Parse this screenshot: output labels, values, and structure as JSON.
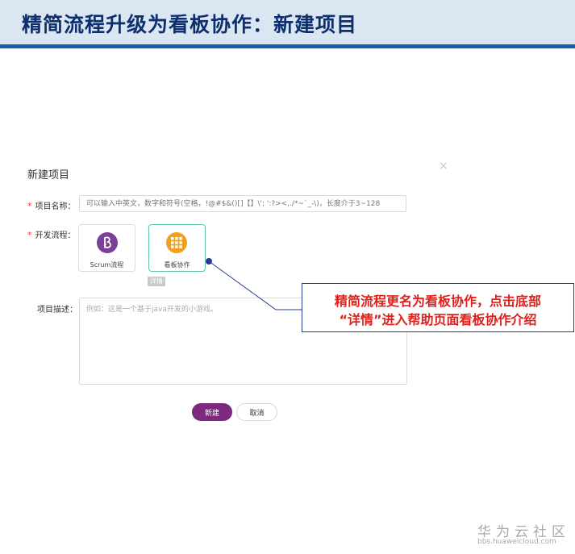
{
  "slide": {
    "title": "精简流程升级为看板协作：新建项目",
    "accent_color": "#1a5fae"
  },
  "dialog": {
    "title": "新建项目",
    "close_glyph": "×",
    "required_mark": "*",
    "name_field": {
      "label": "项目名称：",
      "placeholder": "可以输入中英文，数字和符号(空格，!@#$&()[]【】\\'; ':?><,./*~`_-\\)，长度介于3~128"
    },
    "process_field": {
      "label": "开发流程：",
      "options": [
        {
          "label": "Scrum流程",
          "icon": "scrum-icon",
          "selected": false
        },
        {
          "label": "看板协作",
          "icon": "kanban-icon",
          "selected": true
        }
      ],
      "detail_label": "详情"
    },
    "desc_field": {
      "label": "项目描述：",
      "placeholder": "例如：这是一个基于java开发的小游戏。"
    },
    "buttons": {
      "create": "新建",
      "cancel": "取消"
    }
  },
  "callout": {
    "line1": "精简流程更名为看板协作，点击底部",
    "line2": "“详情”进入帮助页面看板协作介绍"
  },
  "footer": {
    "brand": "华为云社区",
    "url": "bbs.huaweicloud.com"
  }
}
